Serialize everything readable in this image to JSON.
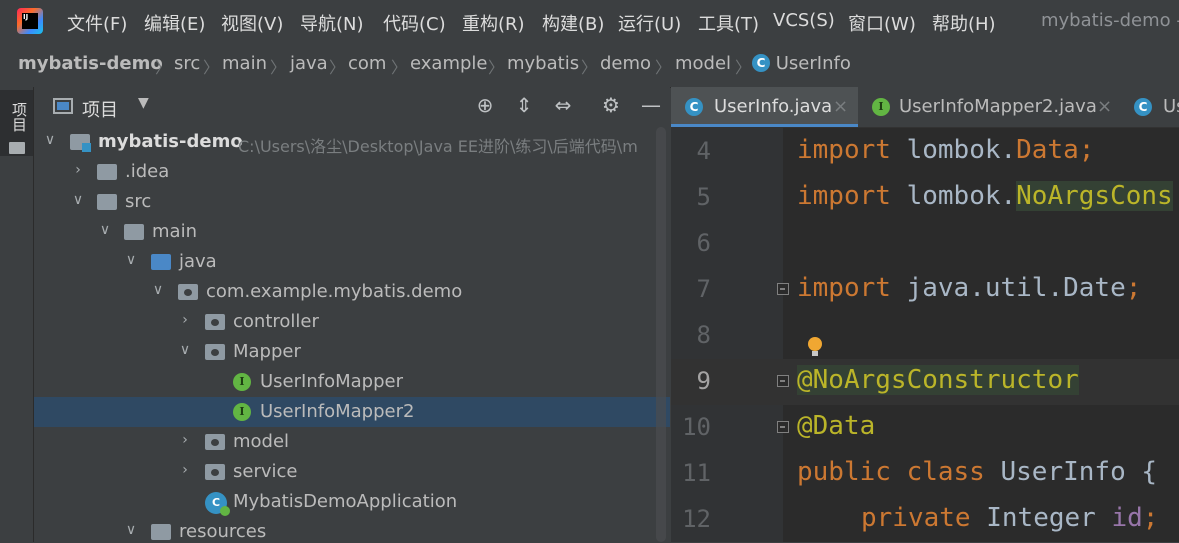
{
  "colors": {
    "accent": "#4a88c7",
    "selection": "#2f4963",
    "keyword": "#cc7832",
    "annotation": "#bbb529"
  },
  "menu": {
    "items": [
      "文件(F)",
      "编辑(E)",
      "视图(V)",
      "导航(N)",
      "代码(C)",
      "重构(R)",
      "构建(B)",
      "运行(U)",
      "工具(T)",
      "VCS(S)",
      "窗口(W)",
      "帮助(H)"
    ],
    "window_title": "mybatis-demo -"
  },
  "breadcrumb": {
    "items": [
      "mybatis-demo",
      "src",
      "main",
      "java",
      "com",
      "example",
      "mybatis",
      "demo",
      "model",
      "UserInfo"
    ],
    "class_icon_letter": "C"
  },
  "left_strip": {
    "label": "项目",
    "icon": "folder-icon"
  },
  "project_panel": {
    "title": "项目",
    "header_icons": [
      "locate-icon",
      "expand-all-icon",
      "collapse-all-icon",
      "settings-icon",
      "hide-icon"
    ],
    "tree": [
      {
        "label": "mybatis-demo",
        "path": "C:\\Users\\洛尘\\Desktop\\Java EE进阶\\练习\\后端代码\\m"
      },
      {
        "label": ".idea"
      },
      {
        "label": "src"
      },
      {
        "label": "main"
      },
      {
        "label": "java"
      },
      {
        "label": "com.example.mybatis.demo"
      },
      {
        "label": "controller"
      },
      {
        "label": "Mapper"
      },
      {
        "label": "UserInfoMapper"
      },
      {
        "label": "UserInfoMapper2"
      },
      {
        "label": "model"
      },
      {
        "label": "service"
      },
      {
        "label": "MybatisDemoApplication"
      },
      {
        "label": "resources"
      }
    ],
    "interface_icon_letter": "I"
  },
  "editor": {
    "tabs": [
      {
        "label": "UserInfo.java",
        "close": "×",
        "icon_letter": "C"
      },
      {
        "label": "UserInfoMapper2.java",
        "close": "×",
        "icon_letter": "I"
      },
      {
        "label": "Us",
        "icon_letter": "C"
      }
    ],
    "current_line": 9,
    "lines": [
      {
        "no": "4",
        "t1": "import",
        "t2": " lombok.",
        "t3": "Data",
        "t4": ";"
      },
      {
        "no": "5",
        "t1": "import",
        "t2": " lombok.",
        "t3": "NoArgsCons",
        "t4": ""
      },
      {
        "no": "6"
      },
      {
        "no": "7",
        "t1": "import",
        "t2": " java.util.Date",
        "t4": ";"
      },
      {
        "no": "8"
      },
      {
        "no": "9",
        "t1": "@NoArgsConstructor"
      },
      {
        "no": "10",
        "t1": "@Data"
      },
      {
        "no": "11",
        "t1": "public class",
        "t2": " UserInfo {"
      },
      {
        "no": "12",
        "t1": "private",
        "t2": " Integer ",
        "t3": "id",
        "t4": ";"
      }
    ]
  }
}
